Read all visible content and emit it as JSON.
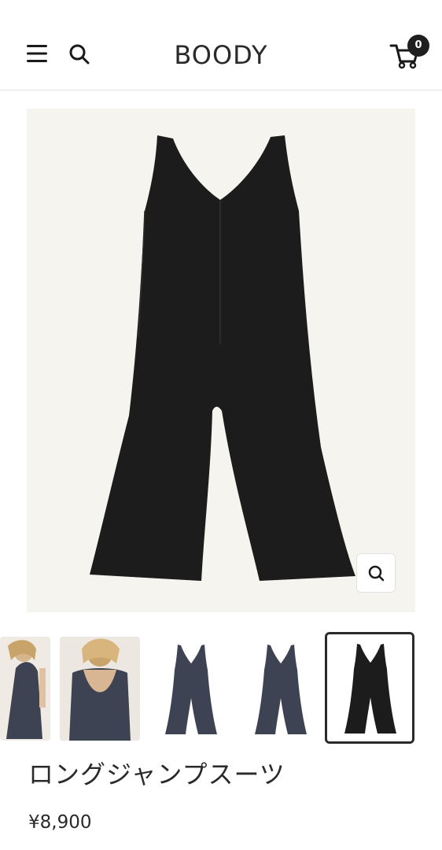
{
  "header": {
    "logo_text": "BOODY",
    "cart_count": "0",
    "icons": [
      "hamburger-menu-icon",
      "search-icon",
      "cart-icon"
    ]
  },
  "product": {
    "title": "ロングジャンプスーツ",
    "price": "¥8,900",
    "selected_color": "#1c1c1c",
    "alt_color": "#3d4352"
  },
  "gallery": {
    "thumbnail_count": 5,
    "active_index": 4
  }
}
